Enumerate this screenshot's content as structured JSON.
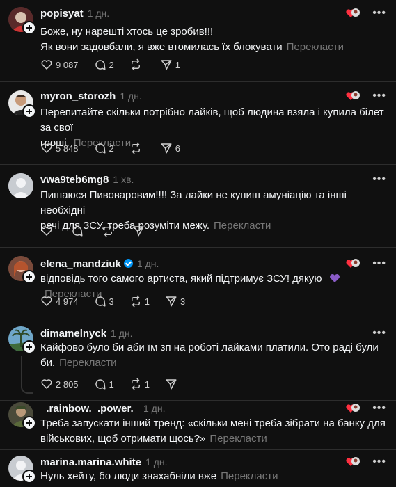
{
  "translate_label": "Перекласти",
  "posts": [
    {
      "username": "popisyat",
      "time": "1 дн.",
      "verified": false,
      "lines": [
        "Боже, ну нарешті хтось це зробив!!!",
        "Як вони задовбали, я вже втомилась їх блокувати"
      ],
      "likes": "9 087",
      "replies": "2",
      "reposts": "",
      "shares": "1"
    },
    {
      "username": "myron_storozh",
      "time": "1 дн.",
      "verified": false,
      "lines": [
        "Перепитайте скільки потрібно лайків, щоб людина взяла і купила білет за свої",
        "гроші."
      ],
      "likes": "5 848",
      "replies": "2",
      "reposts": "",
      "shares": "6"
    },
    {
      "username": "vwa9teb6mg8",
      "time": "1 хв.",
      "verified": false,
      "lines": [
        "Пишаюся Пивоваровим!!!! За лайки не купиш амуніацію та інші необхідні",
        "речі для ЗСУ, треба розуміти межу."
      ],
      "likes": "",
      "replies": "",
      "reposts": "",
      "shares": ""
    },
    {
      "username": "elena_mandziuk",
      "time": "1 дн.",
      "verified": true,
      "lines": [
        "відповідь того самого артиста, який підтримує ЗСУ! дякую"
      ],
      "likes": "4 974",
      "replies": "3",
      "reposts": "1",
      "shares": "3"
    },
    {
      "username": "dimamelnyck",
      "time": "1 дн.",
      "verified": false,
      "lines": [
        "Кайфово було би аби їм зп на роботі лайками платили. Ото раді були",
        "би."
      ],
      "likes": "2 805",
      "replies": "1",
      "reposts": "1",
      "shares": ""
    },
    {
      "username": "_.rainbow._.power._",
      "time": "1 дн.",
      "verified": false,
      "lines": [
        "Треба запускати інший тренд: «скільки мені треба зібрати на банку для",
        "військових, щоб отримати щось?»"
      ],
      "likes": "",
      "replies": "",
      "reposts": "",
      "shares": ""
    },
    {
      "username": "marina.marina.white",
      "time": "1 дн.",
      "verified": false,
      "lines": [
        "Нуль хейту, бо люди знахабніли вже"
      ],
      "likes": "",
      "replies": "",
      "reposts": "",
      "shares": ""
    }
  ],
  "colors": {
    "background": "#101010",
    "text": "#f3f5f7",
    "muted": "#777777",
    "divider": "#2d2d2d",
    "verified": "#0095f6"
  },
  "icons": [
    "heart-icon",
    "reply-icon",
    "repost-icon",
    "share-icon",
    "more-icon",
    "follow-plus-icon",
    "verified-icon"
  ]
}
